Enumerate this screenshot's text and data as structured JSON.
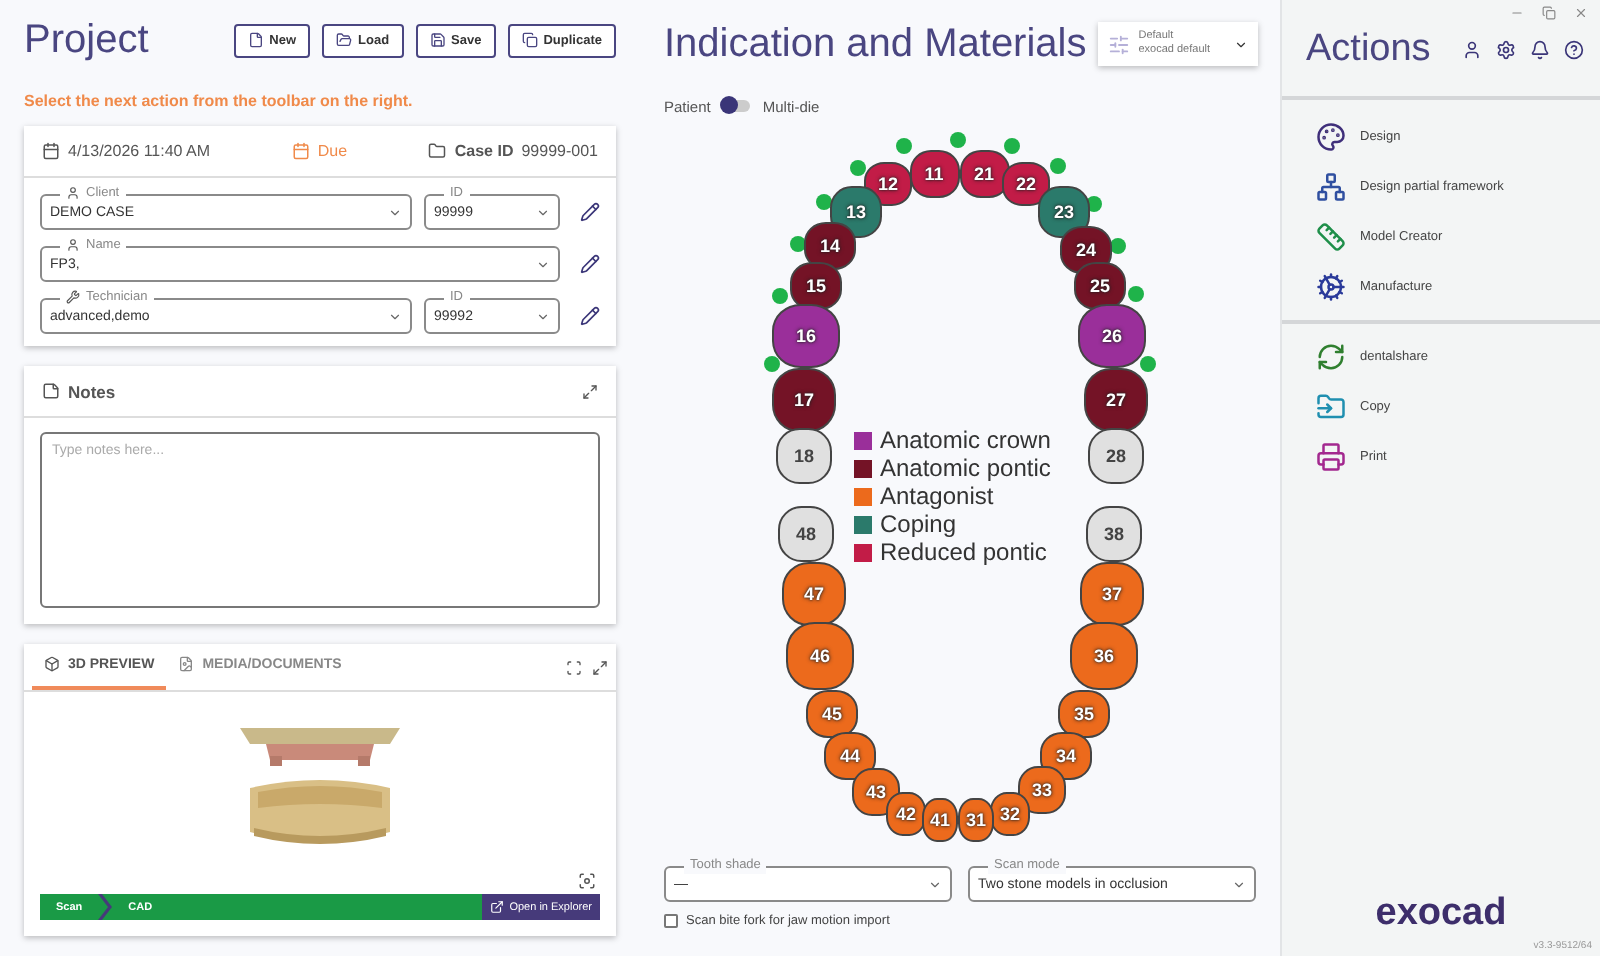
{
  "project": {
    "title": "Project",
    "toolbar": [
      {
        "label": "New",
        "kind": "new"
      },
      {
        "label": "Load",
        "kind": "load"
      },
      {
        "label": "Save",
        "kind": "save"
      },
      {
        "label": "Duplicate",
        "kind": "duplicate"
      }
    ],
    "hint": "Select the next action from the toolbar on the right.",
    "case": {
      "date": "4/13/2026 11:40 AM",
      "due": "Due",
      "case_id_label": "Case ID",
      "case_id": "99999-001"
    },
    "fields": [
      {
        "kind": "person",
        "label": "Client",
        "value": "DEMO CASE",
        "id_label": "ID",
        "id_value": "99999"
      },
      {
        "kind": "person",
        "label": "Name",
        "value": "FP3,"
      },
      {
        "kind": "tool",
        "label": "Technician",
        "value": "advanced,demo",
        "id_label": "ID",
        "id_value": "99992"
      }
    ],
    "notes": {
      "title": "Notes",
      "placeholder": "Type notes here..."
    },
    "preview": {
      "tabs": [
        {
          "label": "3D PREVIEW",
          "kind": "cube",
          "selected": true
        },
        {
          "label": "MEDIA/DOCUMENTS",
          "kind": "file",
          "selected": false
        }
      ],
      "steps": [
        "Scan",
        "CAD"
      ],
      "open_button": "Open in Explorer"
    }
  },
  "indication": {
    "title": "Indication and Materials",
    "profile": {
      "name": "Default",
      "sub": "exocad default"
    },
    "toggle": {
      "left": "Patient",
      "right": "Multi-die",
      "on": false
    },
    "legend": [
      {
        "label": "Anatomic crown",
        "kind": "anatomic_crown",
        "color": "#9a2f9a"
      },
      {
        "label": "Anatomic pontic",
        "kind": "anatomic_pontic",
        "color": "#741326"
      },
      {
        "label": "Antagonist",
        "kind": "antagonist",
        "color": "#ec6a1c"
      },
      {
        "label": "Coping",
        "kind": "coping",
        "color": "#2b7a6b"
      },
      {
        "label": "Reduced pontic",
        "kind": "reduced_pontic",
        "color": "#c21c47"
      }
    ],
    "teeth": [
      {
        "number": "11",
        "kind": "reduced_pontic",
        "connected": true
      },
      {
        "number": "12",
        "kind": "reduced_pontic",
        "connected": true
      },
      {
        "number": "13",
        "kind": "coping",
        "connected": true
      },
      {
        "number": "14",
        "kind": "anatomic_pontic",
        "connected": true
      },
      {
        "number": "15",
        "kind": "anatomic_pontic",
        "connected": true
      },
      {
        "number": "16",
        "kind": "anatomic_crown",
        "connected": true
      },
      {
        "number": "17",
        "kind": "anatomic_pontic",
        "connected": true
      },
      {
        "number": "18",
        "kind": "none",
        "connected": false
      },
      {
        "number": "48",
        "kind": "none"
      },
      {
        "number": "47",
        "kind": "antagonist"
      },
      {
        "number": "46",
        "kind": "antagonist"
      },
      {
        "number": "45",
        "kind": "antagonist"
      },
      {
        "number": "44",
        "kind": "antagonist"
      },
      {
        "number": "43",
        "kind": "antagonist"
      },
      {
        "number": "42",
        "kind": "antagonist"
      },
      {
        "number": "41",
        "kind": "antagonist"
      },
      {
        "number": "21",
        "kind": "reduced_pontic",
        "connected": true
      },
      {
        "number": "22",
        "kind": "reduced_pontic",
        "connected": true
      },
      {
        "number": "23",
        "kind": "coping",
        "connected": true
      },
      {
        "number": "24",
        "kind": "anatomic_pontic",
        "connected": true
      },
      {
        "number": "25",
        "kind": "anatomic_pontic",
        "connected": true
      },
      {
        "number": "26",
        "kind": "anatomic_crown",
        "connected": true
      },
      {
        "number": "27",
        "kind": "anatomic_pontic",
        "connected": false
      },
      {
        "number": "28",
        "kind": "none",
        "connected": false
      },
      {
        "number": "38",
        "kind": "none"
      },
      {
        "number": "37",
        "kind": "antagonist"
      },
      {
        "number": "36",
        "kind": "antagonist"
      },
      {
        "number": "35",
        "kind": "antagonist"
      },
      {
        "number": "34",
        "kind": "antagonist"
      },
      {
        "number": "33",
        "kind": "antagonist"
      },
      {
        "number": "32",
        "kind": "antagonist"
      },
      {
        "number": "31",
        "kind": "antagonist"
      }
    ],
    "tooth_shade": {
      "label": "Tooth shade",
      "value": "—"
    },
    "scan_mode": {
      "label": "Scan mode",
      "value": "Two stone models in occlusion"
    },
    "bite_fork": {
      "label": "Scan bite fork for jaw motion import",
      "checked": false
    }
  },
  "actions": {
    "title": "Actions",
    "groups": [
      [
        {
          "label": "Design",
          "kind": "design",
          "color": "#3f2f7a"
        },
        {
          "label": "Design partial framework",
          "kind": "framework",
          "color": "#2f4fa0"
        },
        {
          "label": "Model Creator",
          "kind": "model",
          "color": "#1f8f4a"
        },
        {
          "label": "Manufacture",
          "kind": "manufacture",
          "color": "#2a3a9a"
        }
      ],
      [
        {
          "label": "dentalshare",
          "kind": "share",
          "color": "#2f7f2f"
        },
        {
          "label": "Copy",
          "kind": "copy",
          "color": "#1f8fb0"
        },
        {
          "label": "Print",
          "kind": "print",
          "color": "#a3288f"
        }
      ]
    ],
    "logo": "exocad",
    "version": "v3.3-9512/64"
  }
}
